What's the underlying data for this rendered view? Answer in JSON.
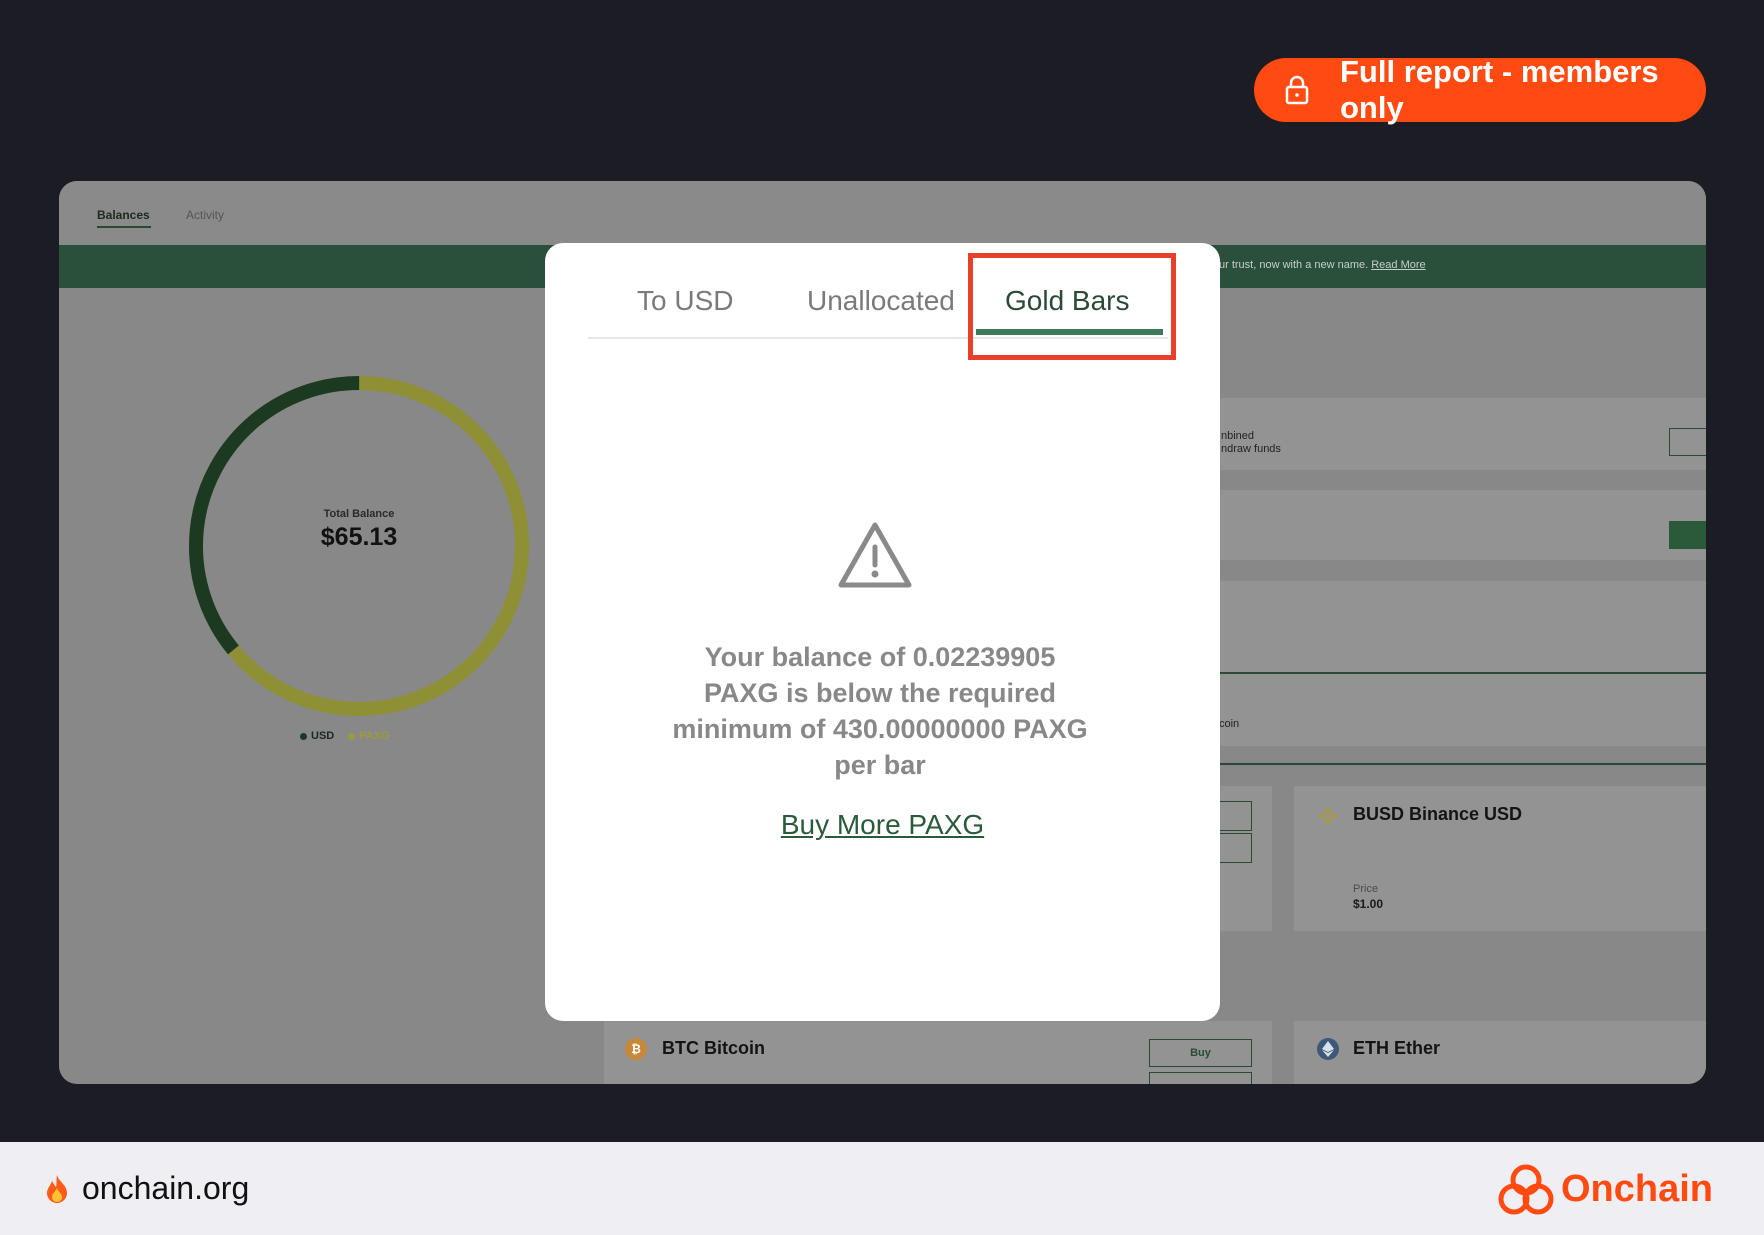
{
  "members_badge": {
    "label": "Full report - members only",
    "icon": "lock-icon"
  },
  "app": {
    "tabs": [
      "Balances",
      "Activity"
    ],
    "banner": {
      "text": "ur trust, now with a new name. ",
      "link": "Read More"
    },
    "total_balance": {
      "label": "Total Balance",
      "value": "$65.13"
    },
    "donut": {
      "usd_fraction": 0.36,
      "paxg_fraction": 0.64,
      "usd_color": "#1c3a22",
      "paxg_color": "#8f8f35"
    },
    "legend": [
      "USD",
      "PAXG"
    ],
    "partial_texts": {
      "combined": "nbined",
      "withdraw": "ndraw funds",
      "coin": "coin"
    },
    "cards": {
      "busd": {
        "title": "BUSD Binance USD",
        "price_label": "Price",
        "price": "$1.00"
      },
      "btc": {
        "title": "BTC Bitcoin",
        "buy": "Buy"
      },
      "eth": {
        "title": "ETH Ether"
      }
    }
  },
  "modal": {
    "tabs": [
      "To USD",
      "Unallocated",
      "Gold Bars"
    ],
    "active_tab": "Gold Bars",
    "message": "Your balance of 0.02239905 PAXG is below the required minimum of 430.00000000 PAXG per bar",
    "link": "Buy More PAXG"
  },
  "footer": {
    "site": "onchain.org",
    "brand": "Onchain"
  },
  "colors": {
    "accent": "#ff4a12",
    "green": "#2b4a36",
    "highlight": "#e8402a"
  }
}
